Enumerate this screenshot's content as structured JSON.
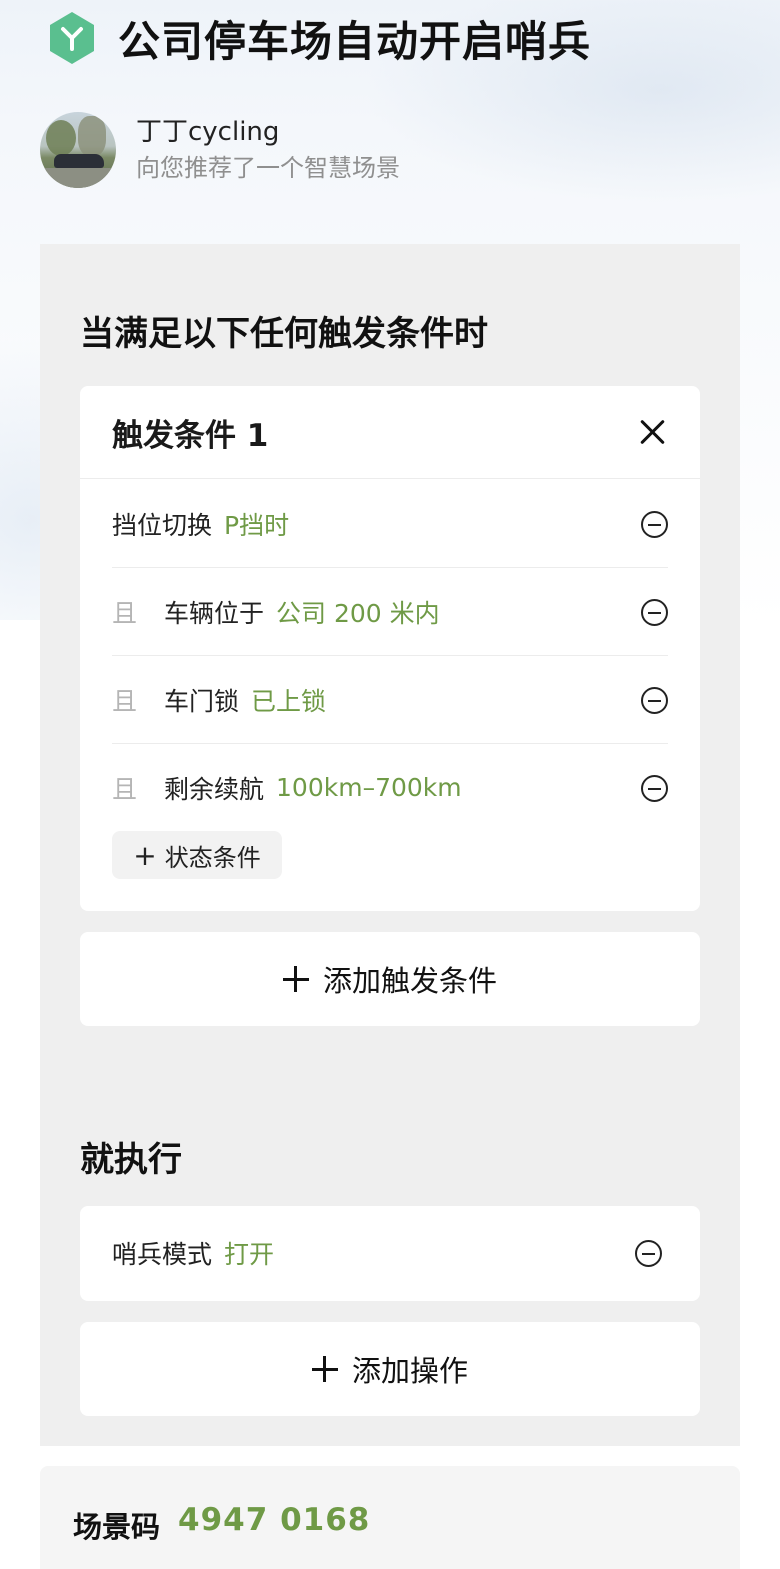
{
  "header": {
    "title": "公司停车场自动开启哨兵",
    "logo_icon": "scene-logo-icon",
    "logo_color": "#5abf8f"
  },
  "author": {
    "name": "丁丁cycling",
    "subtitle": "向您推荐了一个智慧场景"
  },
  "triggers": {
    "section_title": "当满足以下任何触发条件时",
    "card_title": "触发条件 1",
    "primary": {
      "label": "挡位切换",
      "value": "P挡时"
    },
    "conditions": [
      {
        "and": "且",
        "label": "车辆位于",
        "value": "公司 200 米内"
      },
      {
        "and": "且",
        "label": "车门锁",
        "value": "已上锁"
      },
      {
        "and": "且",
        "label": "剩余续航",
        "value": "100km–700km"
      }
    ],
    "add_state_label": "状态条件",
    "add_trigger_label": "添加触发条件"
  },
  "actions": {
    "section_title": "就执行",
    "items": [
      {
        "label": "哨兵模式",
        "value": "打开"
      }
    ],
    "add_action_label": "添加操作"
  },
  "scene_code": {
    "label": "场景码",
    "value": "4947 0168"
  },
  "colors": {
    "accent_green": "#6f9a46",
    "panel_bg": "#efefef"
  }
}
